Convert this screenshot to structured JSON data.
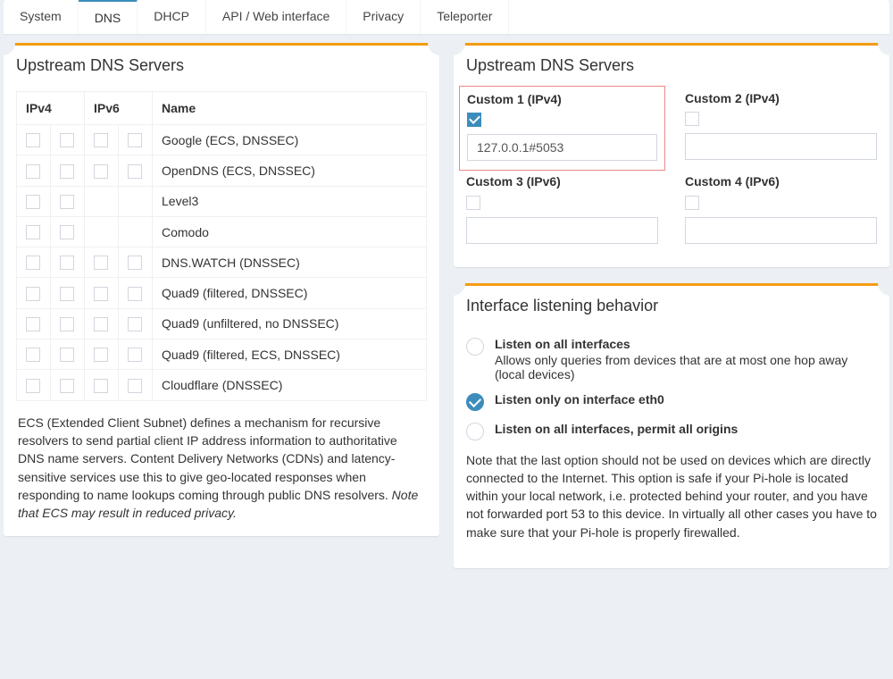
{
  "tabs": {
    "items": [
      {
        "id": "system",
        "label": "System"
      },
      {
        "id": "dns",
        "label": "DNS"
      },
      {
        "id": "dhcp",
        "label": "DHCP"
      },
      {
        "id": "api",
        "label": "API / Web interface"
      },
      {
        "id": "privacy",
        "label": "Privacy"
      },
      {
        "id": "teleporter",
        "label": "Teleporter"
      }
    ],
    "active": "dns"
  },
  "upstream_left": {
    "title": "Upstream DNS Servers",
    "columns": {
      "ipv4": "IPv4",
      "ipv6": "IPv6",
      "name": "Name"
    },
    "providers": [
      {
        "name": "Google (ECS, DNSSEC)",
        "ipv4_slots": 2,
        "ipv6_slots": 2
      },
      {
        "name": "OpenDNS (ECS, DNSSEC)",
        "ipv4_slots": 2,
        "ipv6_slots": 2
      },
      {
        "name": "Level3",
        "ipv4_slots": 2,
        "ipv6_slots": 0
      },
      {
        "name": "Comodo",
        "ipv4_slots": 2,
        "ipv6_slots": 0
      },
      {
        "name": "DNS.WATCH (DNSSEC)",
        "ipv4_slots": 2,
        "ipv6_slots": 2
      },
      {
        "name": "Quad9 (filtered, DNSSEC)",
        "ipv4_slots": 2,
        "ipv6_slots": 2
      },
      {
        "name": "Quad9 (unfiltered, no DNSSEC)",
        "ipv4_slots": 2,
        "ipv6_slots": 2
      },
      {
        "name": "Quad9 (filtered, ECS, DNSSEC)",
        "ipv4_slots": 2,
        "ipv6_slots": 2
      },
      {
        "name": "Cloudflare (DNSSEC)",
        "ipv4_slots": 2,
        "ipv6_slots": 2
      }
    ],
    "ecs_note_main": "ECS (Extended Client Subnet) defines a mechanism for recursive resolvers to send partial client IP address information to authoritative DNS name servers. Content Delivery Networks (CDNs) and latency-sensitive services use this to give geo-located responses when responding to name lookups coming through public DNS resolvers. ",
    "ecs_note_em": "Note that ECS may result in reduced privacy."
  },
  "upstream_right": {
    "title": "Upstream DNS Servers",
    "custom": [
      {
        "key": "c1",
        "label": "Custom 1 (IPv4)",
        "checked": true,
        "value": "127.0.0.1#5053",
        "highlight": true
      },
      {
        "key": "c2",
        "label": "Custom 2 (IPv4)",
        "checked": false,
        "value": ""
      },
      {
        "key": "c3",
        "label": "Custom 3 (IPv6)",
        "checked": false,
        "value": ""
      },
      {
        "key": "c4",
        "label": "Custom 4 (IPv6)",
        "checked": false,
        "value": ""
      }
    ]
  },
  "iface": {
    "title": "Interface listening behavior",
    "options": [
      {
        "id": "all",
        "label": "Listen on all interfaces",
        "sub": "Allows only queries from devices that are at most one hop away (local devices)",
        "checked": false
      },
      {
        "id": "eth0",
        "label": "Listen only on interface eth0",
        "sub": "",
        "checked": true
      },
      {
        "id": "permit",
        "label": "Listen on all interfaces, permit all origins",
        "sub": "",
        "checked": false
      }
    ],
    "note": "Note that the last option should not be used on devices which are directly connected to the Internet. This option is safe if your Pi-hole is located within your local network, i.e. protected behind your router, and you have not forwarded port 53 to this device. In virtually all other cases you have to make sure that your Pi-hole is properly firewalled."
  }
}
